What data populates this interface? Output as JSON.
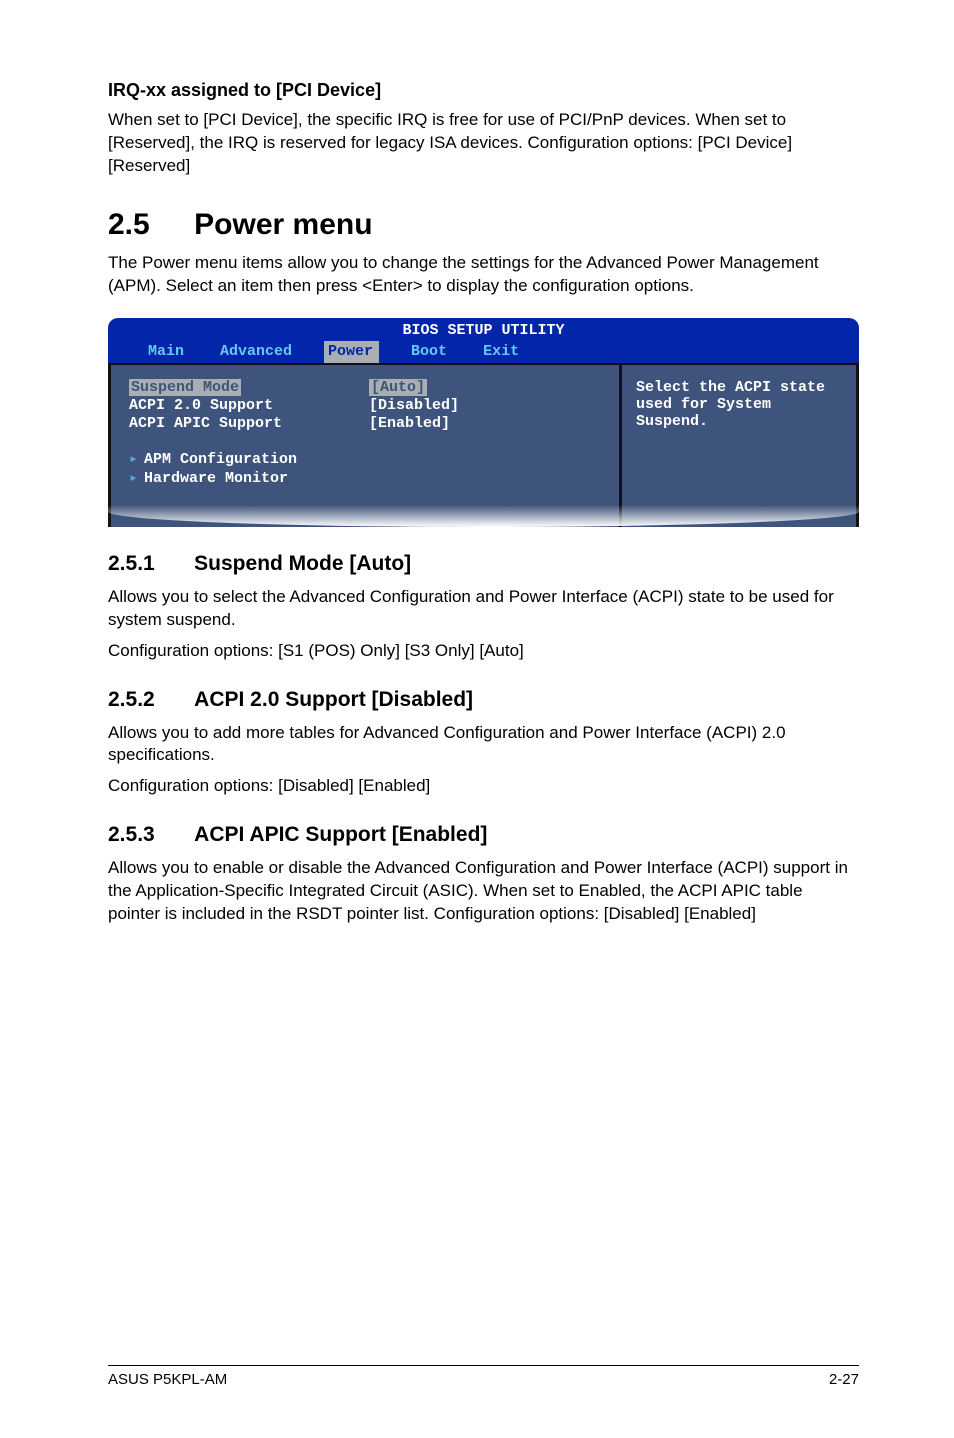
{
  "irq_section": {
    "title": "IRQ-xx assigned to [PCI Device]",
    "body1": "When set to [PCI Device], the specific IRQ is free for use of PCI/PnP devices. When set to [Reserved], the IRQ is reserved for legacy ISA devices. Configuration options: [PCI Device] [Reserved]"
  },
  "section25": {
    "number": "2.5",
    "title": "Power menu",
    "intro": "The Power menu items allow you to change the settings for the Advanced Power Management (APM). Select an item then press <Enter> to display the configuration options."
  },
  "bios": {
    "title": "BIOS SETUP UTILITY",
    "menu": {
      "main": "Main",
      "advanced": "Advanced",
      "power": "Power",
      "boot": "Boot",
      "exit": "Exit"
    },
    "items": {
      "suspend_mode_label": "Suspend Mode",
      "suspend_mode_value": "[Auto]",
      "acpi20_label": "ACPI 2.0 Support",
      "acpi20_value": "[Disabled]",
      "apic_label": "ACPI APIC Support",
      "apic_value": "[Enabled]",
      "apm_config": "APM Configuration",
      "hw_monitor": "Hardware Monitor"
    },
    "help": "Select the ACPI state used for System Suspend."
  },
  "s251": {
    "number": "2.5.1",
    "title": "Suspend Mode [Auto]",
    "body": "Allows you to select the Advanced Configuration and Power Interface (ACPI) state to be used for system suspend.",
    "config": "Configuration options: [S1 (POS) Only] [S3 Only] [Auto]"
  },
  "s252": {
    "number": "2.5.2",
    "title": "ACPI 2.0 Support [Disabled]",
    "body": "Allows you to add more tables for Advanced Configuration and Power Interface (ACPI) 2.0 specifications.",
    "config": "Configuration options: [Disabled] [Enabled]"
  },
  "s253": {
    "number": "2.5.3",
    "title": "ACPI APIC Support [Enabled]",
    "body": "Allows you to enable or disable the Advanced Configuration and Power Interface (ACPI) support in the Application-Specific Integrated Circuit (ASIC). When set to Enabled, the ACPI APIC table pointer is included in the RSDT pointer list. Configuration options: [Disabled] [Enabled]"
  },
  "footer": {
    "left": "ASUS P5KPL-AM",
    "right": "2-27"
  }
}
